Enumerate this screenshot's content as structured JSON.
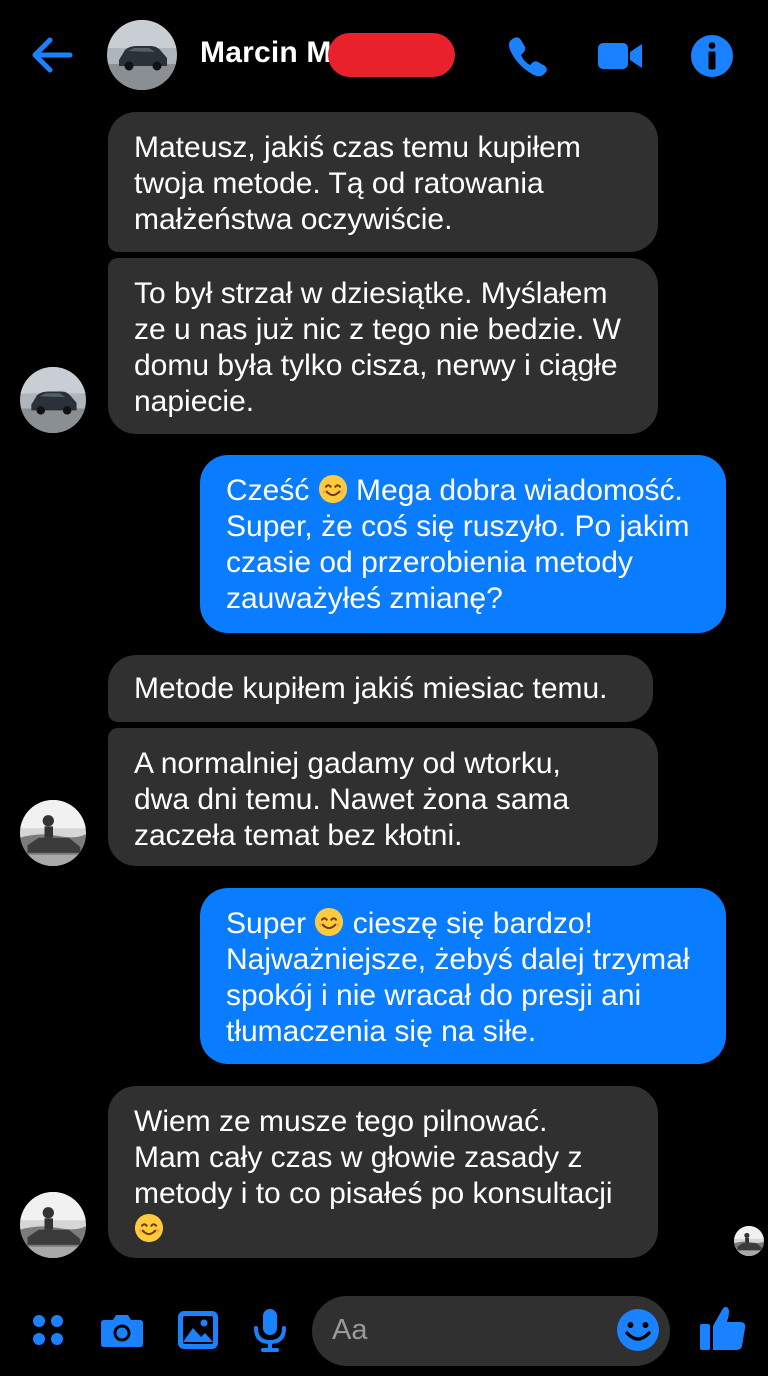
{
  "header": {
    "contact_name": "Marcin M",
    "icons": [
      "back-arrow-icon",
      "phone-icon",
      "video-camera-icon",
      "info-icon"
    ]
  },
  "colors": {
    "accent": "#0a7cff",
    "incoming_bubble": "#303030",
    "background": "#000000",
    "redaction": "#e8212b"
  },
  "messages": [
    {
      "direction": "in",
      "lines": [
        "Mateusz, jakiś czas temu kupiłem",
        "twoja metode. Tą od ratowania",
        "małżeństwa oczywiście."
      ]
    },
    {
      "direction": "in",
      "lines": [
        "To był strzał w dziesiątke. Myślałem",
        "ze u nas już nic z tego nie bedzie. W",
        "domu była tylko cisza, nerwy i ciągłe",
        "napiecie."
      ]
    },
    {
      "direction": "out",
      "lines": [
        "Cześć",
        "Mega dobra wiadomość.",
        "Super, że coś się ruszyło. Po jakim",
        "czasie od przerobienia metody",
        "zauważyłeś zmianę?"
      ]
    },
    {
      "direction": "in",
      "lines": [
        "Metode kupiłem jakiś miesiac temu."
      ]
    },
    {
      "direction": "in",
      "lines": [
        "A normalniej gadamy od wtorku,",
        "dwa dni temu. Nawet żona sama",
        "zaczeła temat bez kłotni."
      ]
    },
    {
      "direction": "out",
      "lines": [
        "Super",
        "cieszę się bardzo!",
        "Najważniejsze, żebyś dalej trzymał",
        "spokój i nie wracał do presji ani",
        "tłumaczenia się na siłe."
      ]
    },
    {
      "direction": "in",
      "lines": [
        "Wiem ze musze tego pilnować.",
        "Mam cały czas w głowie zasady z",
        "metody i to co pisałeś po konsultacji"
      ]
    }
  ],
  "composer": {
    "placeholder": "Aa",
    "icons": [
      "apps-grid-icon",
      "camera-icon",
      "gallery-icon",
      "microphone-icon",
      "emoji-icon",
      "thumbs-up-icon"
    ]
  }
}
